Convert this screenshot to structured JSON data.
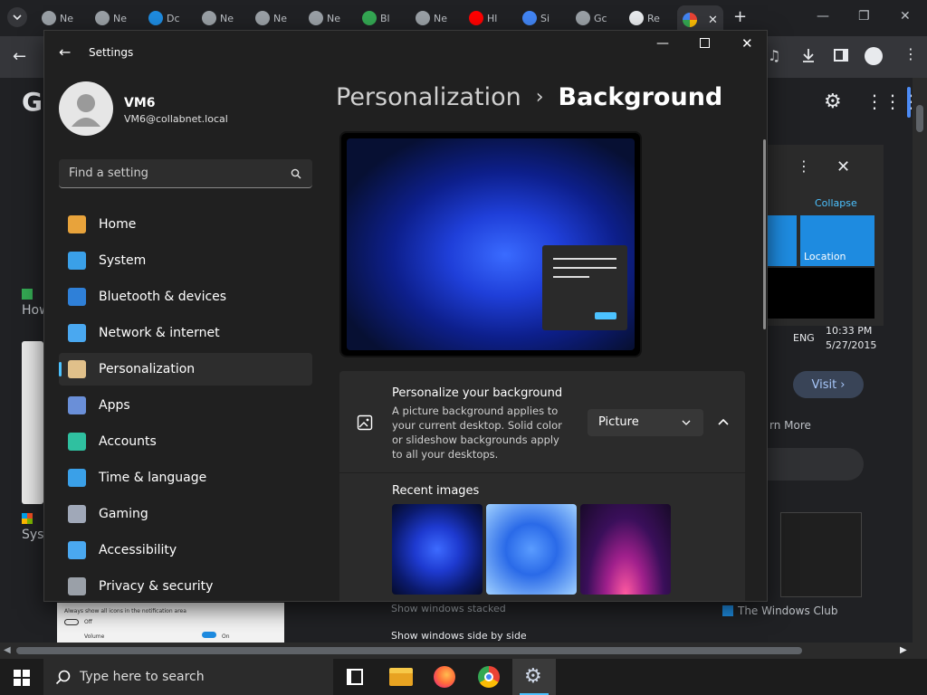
{
  "browser": {
    "tabs": [
      {
        "label": "Ne",
        "icon": "chrome-icon"
      },
      {
        "label": "Ne",
        "icon": "chrome-icon"
      },
      {
        "label": "Dc",
        "icon": "sf-icon"
      },
      {
        "label": "Ne",
        "icon": "chrome-icon"
      },
      {
        "label": "Ne",
        "icon": "chrome-icon"
      },
      {
        "label": "Ne",
        "icon": "chrome-icon"
      },
      {
        "label": "Bl",
        "icon": "drive-icon"
      },
      {
        "label": "Ne",
        "icon": "chrome-icon"
      },
      {
        "label": "Hl",
        "icon": "youtube-icon"
      },
      {
        "label": "Si",
        "icon": "google-icon"
      },
      {
        "label": "Gc",
        "icon": "chrome-icon"
      },
      {
        "label": "Re",
        "icon": "github-icon"
      }
    ],
    "new_tab": "+",
    "page_bits": {
      "g_letter": "G",
      "collapse": "Collapse",
      "location": "Location",
      "eng": "ENG",
      "time": "10:33 PM",
      "date": "5/27/2015",
      "visit": "Visit",
      "learn_more": "rn More",
      "how": "How",
      "sys": "Syst",
      "twc": "The Windows Club",
      "notif_text": "Always show all icons in the notification area",
      "off_label": "Off",
      "volume": "Volume",
      "on_label": "On",
      "show_windows_stacked": "Show windows stacked",
      "show_windows_side": "Show windows side by side"
    }
  },
  "settings": {
    "title": "Settings",
    "user": {
      "name": "VM6",
      "email": "VM6@collabnet.local"
    },
    "search_placeholder": "Find a setting",
    "nav": [
      {
        "label": "Home",
        "icon": "home-icon",
        "color": "#e8a33b"
      },
      {
        "label": "System",
        "icon": "system-icon",
        "color": "#3aa0e8"
      },
      {
        "label": "Bluetooth & devices",
        "icon": "bluetooth-icon",
        "color": "#2f80d8"
      },
      {
        "label": "Network & internet",
        "icon": "wifi-icon",
        "color": "#4aa8f0"
      },
      {
        "label": "Personalization",
        "icon": "brush-icon",
        "color": "#e0c08a"
      },
      {
        "label": "Apps",
        "icon": "apps-icon",
        "color": "#6a8fd8"
      },
      {
        "label": "Accounts",
        "icon": "accounts-icon",
        "color": "#2fc0a0"
      },
      {
        "label": "Time & language",
        "icon": "globe-clock-icon",
        "color": "#3aa0e8"
      },
      {
        "label": "Gaming",
        "icon": "gaming-icon",
        "color": "#a0a8b8"
      },
      {
        "label": "Accessibility",
        "icon": "accessibility-icon",
        "color": "#4aa8f0"
      },
      {
        "label": "Privacy & security",
        "icon": "shield-icon",
        "color": "#9aa0a8"
      }
    ],
    "breadcrumb": {
      "parent": "Personalization",
      "separator": "›",
      "current": "Background"
    },
    "personalize": {
      "title": "Personalize your background",
      "description": "A picture background applies to your current desktop. Solid color or slideshow backgrounds apply to all your desktops.",
      "dropdown_value": "Picture"
    },
    "recent_images_label": "Recent images"
  },
  "taskbar": {
    "search_placeholder": "Type here to search"
  },
  "colors": {
    "accent": "#4cc2ff",
    "settings_bg": "#202020",
    "card_bg": "#2b2b2b"
  }
}
